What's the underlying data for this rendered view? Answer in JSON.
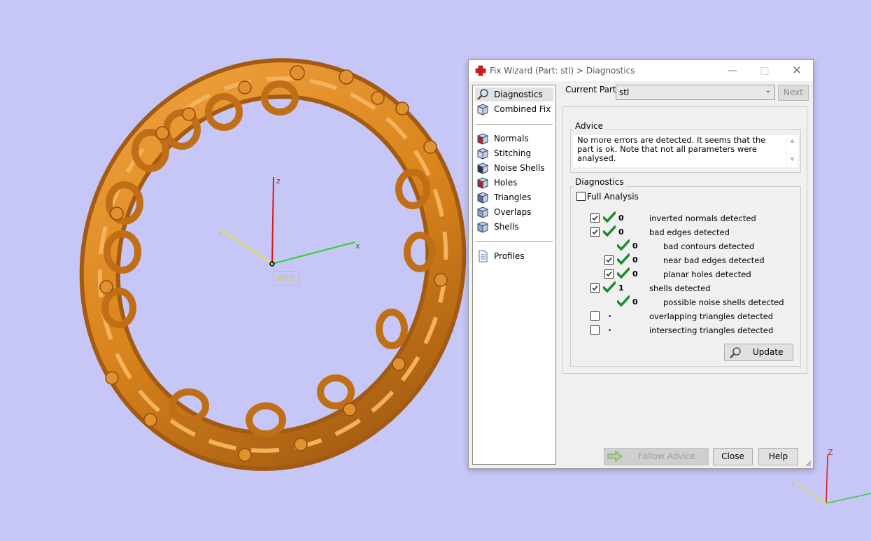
{
  "viewport": {
    "wcs_label": "WCS",
    "axis_x": "x",
    "axis_y": "y",
    "axis_z": "z",
    "mini_axis_z": "Z",
    "mini_axis_y": "Y",
    "model_color": "#d9841c",
    "background": "#c6c6f7"
  },
  "dialog": {
    "title": "Fix Wizard (Part: stl) > Diagnostics",
    "nav": {
      "items_top": [
        {
          "label": "Diagnostics",
          "icon": "magnifier-icon",
          "selected": true
        },
        {
          "label": "Combined Fix",
          "icon": "cube-icon"
        }
      ],
      "items_mid": [
        {
          "label": "Normals",
          "icon": "normals-cube-icon"
        },
        {
          "label": "Stitching",
          "icon": "stitching-cube-icon"
        },
        {
          "label": "Noise Shells",
          "icon": "noise-cube-icon"
        },
        {
          "label": "Holes",
          "icon": "holes-cube-icon"
        },
        {
          "label": "Triangles",
          "icon": "triangles-cube-icon"
        },
        {
          "label": "Overlaps",
          "icon": "overlaps-cube-icon"
        },
        {
          "label": "Shells",
          "icon": "shells-cube-icon"
        }
      ],
      "items_bottom": [
        {
          "label": "Profiles",
          "icon": "document-icon"
        }
      ]
    },
    "current_part_label": "Current Part:",
    "current_part_value": "stl",
    "next_label": "Next",
    "advice_title": "Advice",
    "advice_text": "No more errors are detected. It seems that the part is ok. Note that not all parameters were analysed.",
    "diagnostics_title": "Diagnostics",
    "full_analysis_label": "Full Analysis",
    "full_analysis_checked": false,
    "rows": [
      {
        "checked": true,
        "has_checkbox": true,
        "ok": true,
        "count": "0",
        "label": "inverted normals detected",
        "indent": 0
      },
      {
        "checked": true,
        "has_checkbox": true,
        "ok": true,
        "count": "0",
        "label": "bad edges detected",
        "indent": 0
      },
      {
        "checked": false,
        "has_checkbox": false,
        "ok": true,
        "count": "0",
        "label": "bad contours detected",
        "indent": 1
      },
      {
        "checked": true,
        "has_checkbox": true,
        "ok": true,
        "count": "0",
        "label": "near bad edges detected",
        "indent": 1
      },
      {
        "checked": true,
        "has_checkbox": true,
        "ok": true,
        "count": "0",
        "label": "planar holes detected",
        "indent": 1
      },
      {
        "checked": true,
        "has_checkbox": true,
        "ok": true,
        "count": "1",
        "label": "shells detected",
        "indent": 0
      },
      {
        "checked": false,
        "has_checkbox": false,
        "ok": true,
        "count": "0",
        "label": "possible noise shells detected",
        "indent": 1
      },
      {
        "checked": false,
        "has_checkbox": true,
        "ok": false,
        "count": "",
        "label": "overlapping triangles detected",
        "indent": 0
      },
      {
        "checked": false,
        "has_checkbox": true,
        "ok": false,
        "count": "",
        "label": "intersecting triangles detected",
        "indent": 0
      }
    ],
    "update_label": "Update",
    "follow_advice_label": "Follow Advice",
    "close_label": "Close",
    "help_label": "Help"
  }
}
